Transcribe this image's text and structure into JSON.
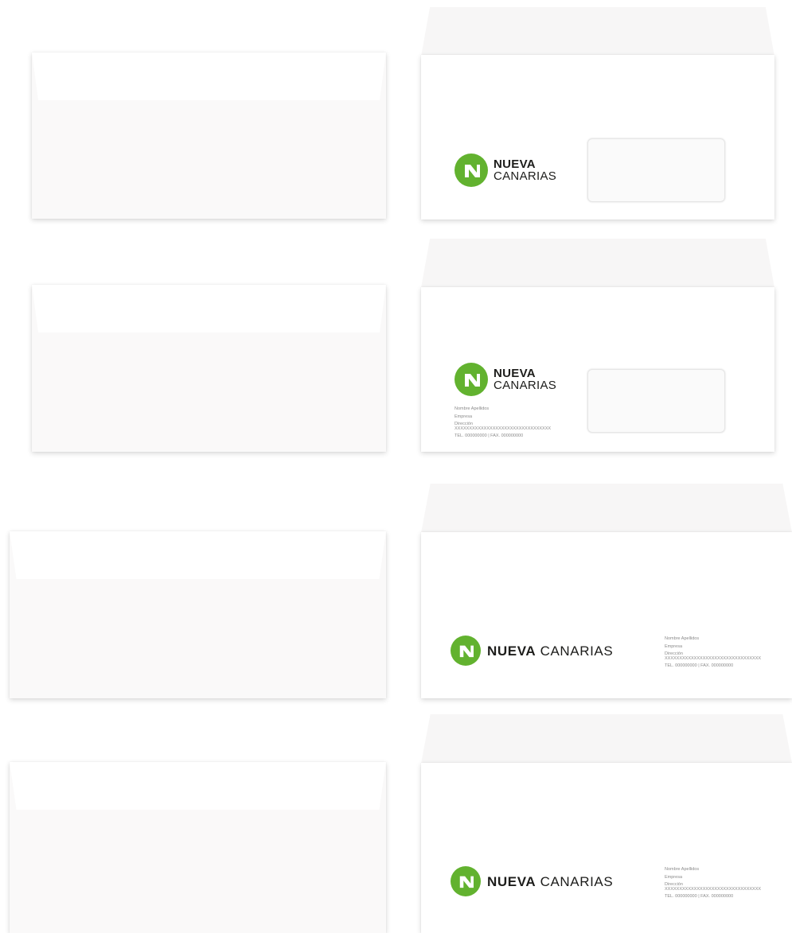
{
  "brand": {
    "strong": "NUEVA",
    "light": "CANARIAS",
    "color": "#62b22f"
  },
  "sender": {
    "name": "Nombre Apellidos",
    "company": "Empresa",
    "address_label": "Dirección",
    "address_value": "XXXXXXXXXXXXXXXXXXXXXXXXXXXXXXXXX",
    "phone": "TEL. 000000000 | FAX. 000000000"
  },
  "icons": {
    "logo": "nueva-canarias-n-logo-icon"
  }
}
